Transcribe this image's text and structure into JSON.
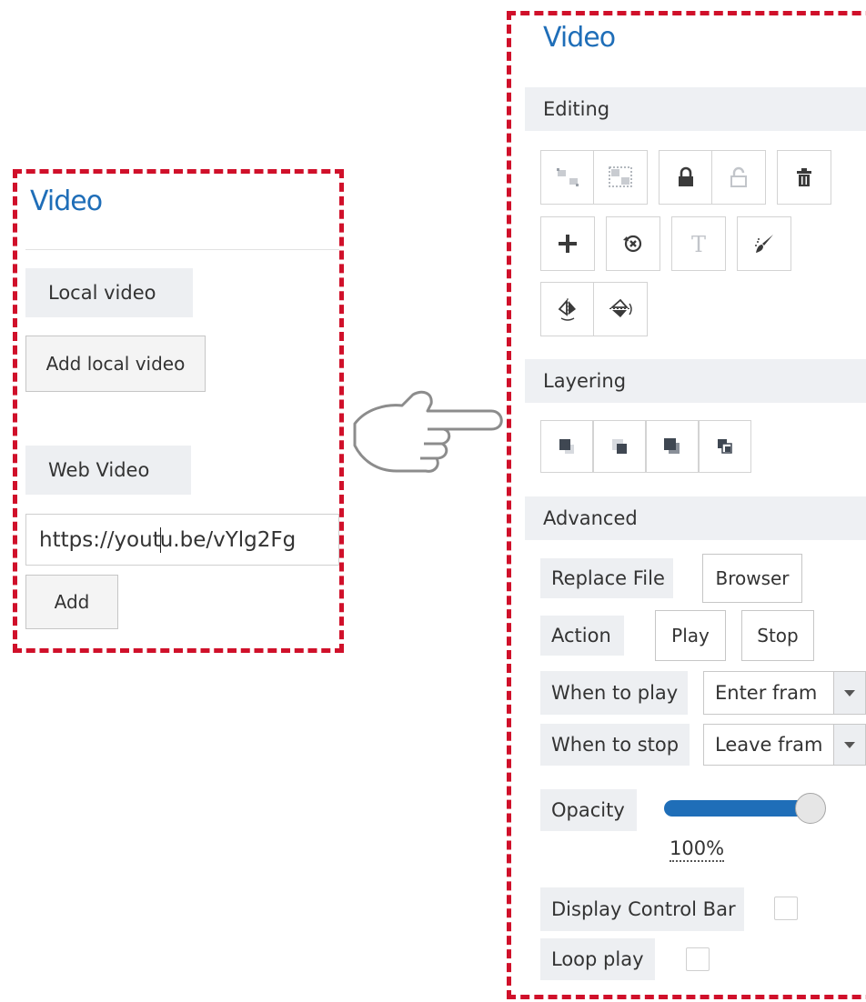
{
  "left_panel": {
    "title": "Video",
    "local_video": {
      "label": "Local video",
      "button": "Add local video"
    },
    "web_video": {
      "label": "Web Video",
      "url_before_caret": "https://yout",
      "url_after_caret": "u.be/vYlg2Fg",
      "add_button": "Add"
    }
  },
  "right_panel": {
    "title": "Video",
    "editing": {
      "header": "Editing",
      "tools": [
        "group-icon",
        "ungroup-icon",
        "lock-icon",
        "unlock-icon",
        "delete-icon",
        "add-icon",
        "reset-rotation-icon",
        "text-icon",
        "brush-icon",
        "flip-horizontal-icon",
        "flip-vertical-icon"
      ]
    },
    "layering": {
      "header": "Layering",
      "tools": [
        "bring-to-front-icon",
        "send-to-back-icon",
        "bring-forward-icon",
        "send-backward-icon"
      ]
    },
    "advanced": {
      "header": "Advanced",
      "replace_file_label": "Replace File",
      "browser_button": "Browser",
      "action_label": "Action",
      "play_button": "Play",
      "stop_button": "Stop",
      "when_to_play_label": "When to play",
      "when_to_play_value": "Enter fram",
      "when_to_stop_label": "When to stop",
      "when_to_stop_value": "Leave fram",
      "opacity_label": "Opacity",
      "opacity_value": "100%",
      "opacity_level": 1.0,
      "display_control_bar_label": "Display Control Bar",
      "display_control_bar_checked": false,
      "loop_play_label": "Loop play",
      "loop_play_checked": false
    }
  },
  "pointer": {
    "icon": "pointing-hand-icon"
  },
  "colors": {
    "accent": "#1f6eb8",
    "frame": "#d0102a",
    "slider": "#1f6eb8"
  }
}
